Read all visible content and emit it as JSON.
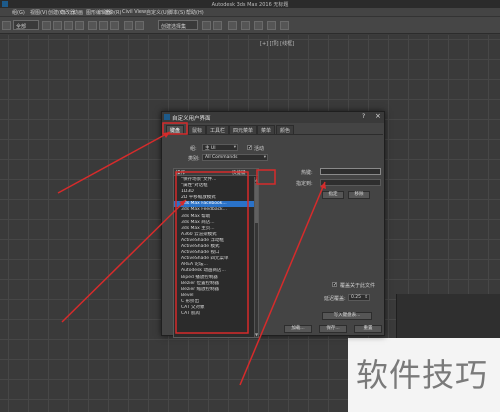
{
  "window": {
    "title": "Autodesk 3ds Max 2016    无标题"
  },
  "menubar": {
    "items": [
      "组(G)",
      "视图(V)",
      "创建(C)",
      "修改器",
      "动画",
      "图形编辑器",
      "渲染(R)",
      "Civil View",
      "自定义(U)",
      "脚本(S)",
      "帮助(H)"
    ]
  },
  "toolbar": {
    "selection_filter": "全部",
    "named_selection": "创建选择集"
  },
  "viewport": {
    "label": "[+] [顶] [线框]"
  },
  "dialog": {
    "title": "自定义用户界面",
    "help": "?",
    "close": "×",
    "tabs": [
      "键盘",
      "鼠标",
      "工具栏",
      "四元菜单",
      "菜单",
      "颜色"
    ],
    "group_label": "组:",
    "group_value": "主 UI",
    "active_label": "活动",
    "active_checked": true,
    "category_label": "类别:",
    "category_value": "All Commands",
    "list_col_action": "操作",
    "list_col_shortcut": "快捷键",
    "list_items": [
      "\"保存场景\"文件...",
      "\"属性\"对话框",
      "1D3D",
      "2D 平移缩放模式",
      "3ds Max Facebook...",
      "3ds Max Feedback...",
      "3ds Max 帮助",
      "3ds Max 商店...",
      "3ds Max 主页...",
      "A360 云渲染模式",
      "ActiveShade 浮动框",
      "ActiveShade 模式",
      "ActiveShade 视口",
      "ActiveShade 四元菜单",
      "AREA 论坛...",
      "Autodesk 动画商店...",
      "Biped 播放控制器",
      "Bezier 位置控制器",
      "Bezier 缩放控制器",
      "Bevel",
      "C 形挤出",
      "CAT 父对象",
      "CAT 肌肉"
    ],
    "selected_index": 4,
    "hotkey_label": "热键:",
    "assigned_label": "指定到:",
    "assign_button": "指定",
    "remove_button": "移除",
    "overwrite_label": "覆盖关于此文件",
    "overwrite_checked": true,
    "delay_label": "延迟覆盖:",
    "delay_value": "0.25",
    "write_button": "写入键盘表...",
    "load_button": "加载...",
    "save_button": "保存...",
    "reset_button": "重置"
  },
  "watermark": "软件技巧",
  "colors": {
    "annotation": "#d62b2b",
    "selection": "#2a72c8"
  }
}
